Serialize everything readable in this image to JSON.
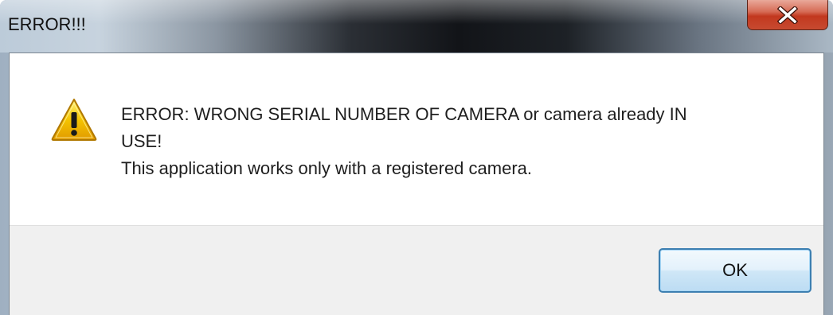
{
  "window": {
    "title": "ERROR!!!",
    "close_icon": "close-icon"
  },
  "dialog": {
    "icon": "warning-icon",
    "message_line_1": "ERROR: WRONG SERIAL NUMBER OF CAMERA or camera already IN",
    "message_line_2": "USE!",
    "message_line_3": "This application works only with a registered camera."
  },
  "buttons": {
    "ok_label": "OK"
  },
  "colors": {
    "close_button": "#c7432a",
    "ok_border": "#3c7fb1",
    "warning_yellow": "#f5c400"
  }
}
